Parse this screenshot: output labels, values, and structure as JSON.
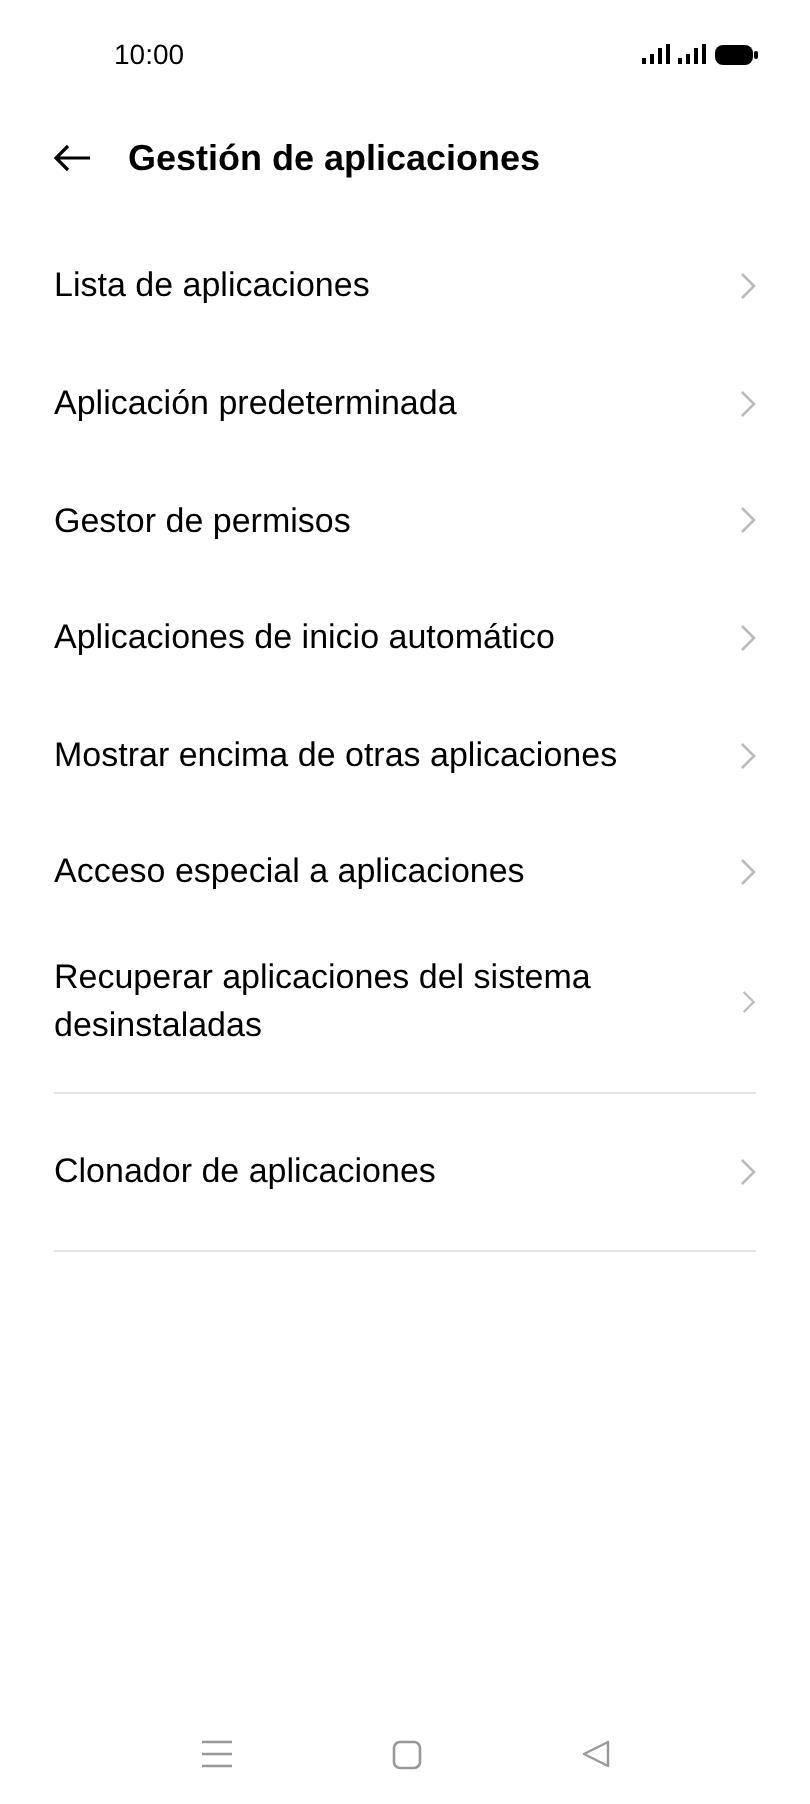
{
  "status_bar": {
    "time": "10:00"
  },
  "header": {
    "title": "Gestión de aplicaciones"
  },
  "groups": [
    {
      "items": [
        {
          "label": "Lista de aplicaciones"
        },
        {
          "label": "Aplicación predeterminada"
        },
        {
          "label": "Gestor de permisos"
        },
        {
          "label": "Aplicaciones de inicio automático"
        },
        {
          "label": "Mostrar encima de otras aplicaciones"
        },
        {
          "label": "Acceso especial a aplicaciones"
        },
        {
          "label": "Recuperar aplicaciones del sistema desinstaladas"
        }
      ]
    },
    {
      "items": [
        {
          "label": "Clonador de aplicaciones"
        }
      ]
    }
  ]
}
